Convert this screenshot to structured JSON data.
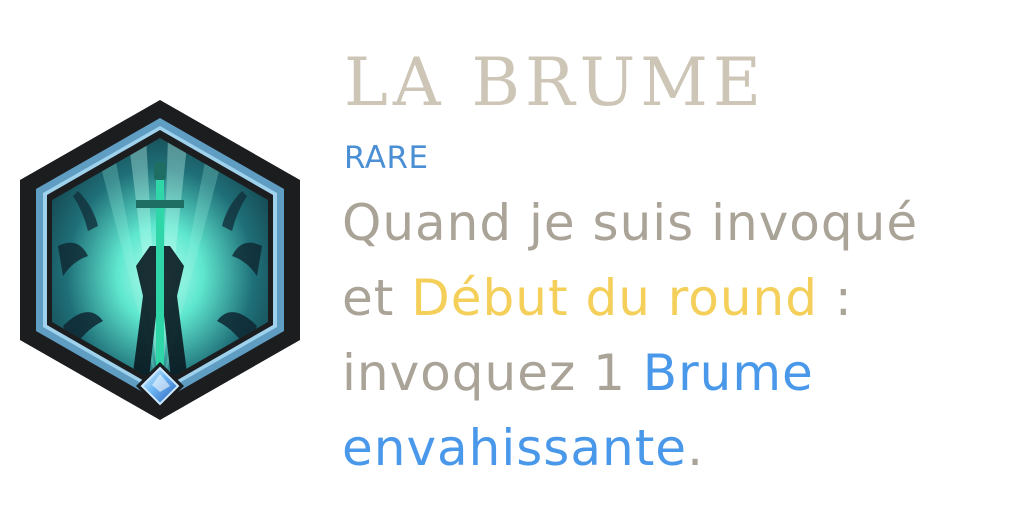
{
  "card": {
    "title": "LA BRUME",
    "rarity": "RARE",
    "description": {
      "line1": "Quand je suis invoqué",
      "line2_prefix": "et ",
      "line2_keyword": "Début du round",
      "line2_suffix": " :",
      "line3_prefix": "invoquez 1 ",
      "line3_card": "Brume",
      "line4_card": "envahissante",
      "line4_suffix": "."
    }
  },
  "colors": {
    "title": "#cdc6b7",
    "rarity": "#4b8fd4",
    "text": "#aaa397",
    "keyword_gold": "#f4cf5a",
    "keyword_blue": "#4a98ea",
    "frame_outer": "#1b1d1f",
    "frame_ring": "#5f9dc2",
    "art_glow": "#5ff0d4"
  },
  "icons": {
    "emblem": "hexagon-champion-portrait-icon",
    "gem": "diamond-gem-icon"
  }
}
